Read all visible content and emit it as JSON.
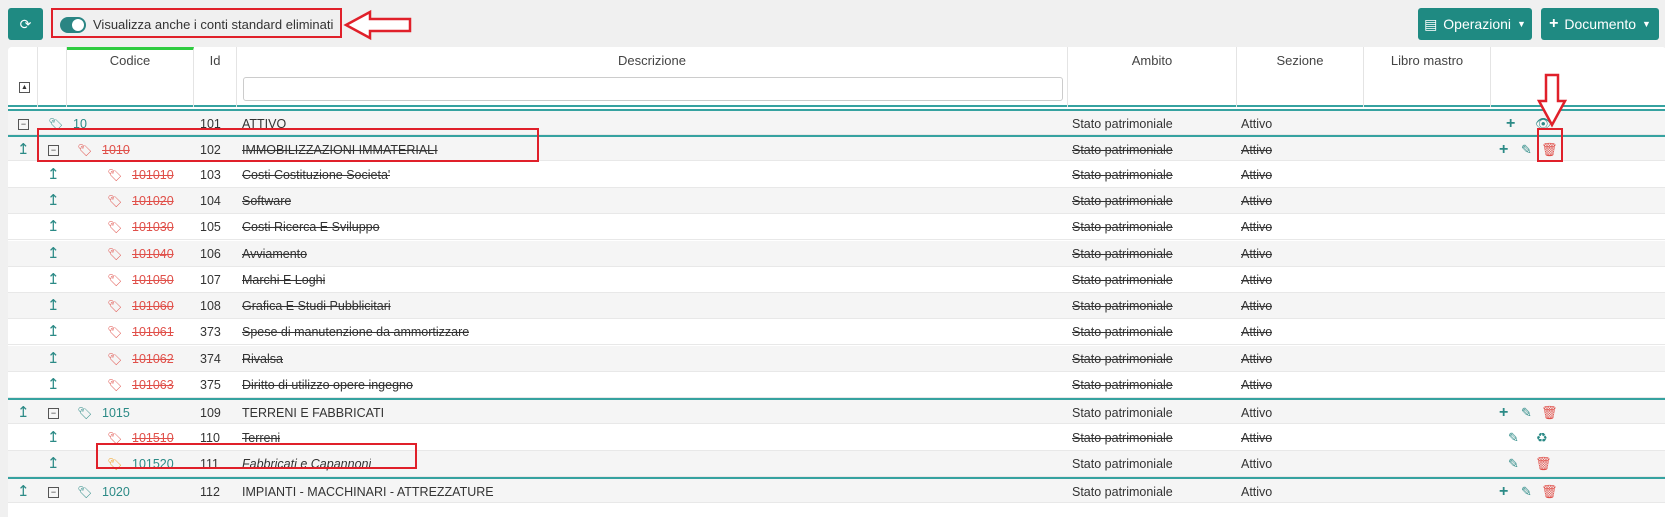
{
  "toolbar": {
    "refresh_icon": "refresh-icon",
    "toggle_label": "Visualizza anche i conti standard eliminati",
    "toggle_on": true,
    "operazioni_label": "Operazioni",
    "documento_label": "Documento",
    "accent": "#1f8a82"
  },
  "table": {
    "columns": [
      "Codice",
      "Id",
      "Descrizione",
      "Ambito",
      "Sezione",
      "Libro mastro"
    ],
    "description_filter_value": "",
    "rows": [
      {
        "codice": "10",
        "id": "101",
        "descrizione": "ATTIVO",
        "ambito": "Stato patrimoniale",
        "sezione": "Attivo",
        "deleted": false,
        "level": 0,
        "expandable": true,
        "tag": "teal",
        "actions": [
          "plus",
          "eye"
        ]
      },
      {
        "codice": "1010",
        "id": "102",
        "descrizione": "IMMOBILIZZAZIONI IMMATERIALI",
        "ambito": "Stato patrimoniale",
        "sezione": "Attivo",
        "deleted": true,
        "level": 1,
        "expandable": true,
        "tag": "red",
        "actions": [
          "plus",
          "edit",
          "trash"
        ]
      },
      {
        "codice": "101010",
        "id": "103",
        "descrizione": "Costi Costituzione Societa'",
        "ambito": "Stato patrimoniale",
        "sezione": "Attivo",
        "deleted": true,
        "level": 2,
        "tag": "red",
        "actions": []
      },
      {
        "codice": "101020",
        "id": "104",
        "descrizione": "Software",
        "ambito": "Stato patrimoniale",
        "sezione": "Attivo",
        "deleted": true,
        "level": 2,
        "tag": "red",
        "actions": []
      },
      {
        "codice": "101030",
        "id": "105",
        "descrizione": "Costi Ricerca E Sviluppo",
        "ambito": "Stato patrimoniale",
        "sezione": "Attivo",
        "deleted": true,
        "level": 2,
        "tag": "red",
        "actions": []
      },
      {
        "codice": "101040",
        "id": "106",
        "descrizione": "Avviamento",
        "ambito": "Stato patrimoniale",
        "sezione": "Attivo",
        "deleted": true,
        "level": 2,
        "tag": "red",
        "actions": []
      },
      {
        "codice": "101050",
        "id": "107",
        "descrizione": "Marchi E Loghi",
        "ambito": "Stato patrimoniale",
        "sezione": "Attivo",
        "deleted": true,
        "level": 2,
        "tag": "red",
        "actions": []
      },
      {
        "codice": "101060",
        "id": "108",
        "descrizione": "Grafica E Studi Pubblicitari",
        "ambito": "Stato patrimoniale",
        "sezione": "Attivo",
        "deleted": true,
        "level": 2,
        "tag": "red",
        "actions": []
      },
      {
        "codice": "101061",
        "id": "373",
        "descrizione": "Spese di manutenzione da ammortizzare",
        "ambito": "Stato patrimoniale",
        "sezione": "Attivo",
        "deleted": true,
        "level": 2,
        "tag": "red",
        "actions": []
      },
      {
        "codice": "101062",
        "id": "374",
        "descrizione": "Rivalsa",
        "ambito": "Stato patrimoniale",
        "sezione": "Attivo",
        "deleted": true,
        "level": 2,
        "tag": "red",
        "actions": []
      },
      {
        "codice": "101063",
        "id": "375",
        "descrizione": "Diritto di utilizzo opere ingegno",
        "ambito": "Stato patrimoniale",
        "sezione": "Attivo",
        "deleted": true,
        "level": 2,
        "tag": "red",
        "actions": []
      },
      {
        "codice": "1015",
        "id": "109",
        "descrizione": "TERRENI E FABBRICATI",
        "ambito": "Stato patrimoniale",
        "sezione": "Attivo",
        "deleted": false,
        "level": 1,
        "expandable": true,
        "tag": "teal",
        "actions": [
          "plus",
          "edit",
          "trash"
        ]
      },
      {
        "codice": "101510",
        "id": "110",
        "descrizione": "Terreni",
        "ambito": "Stato patrimoniale",
        "sezione": "Attivo",
        "deleted": true,
        "level": 2,
        "tag": "red",
        "actions": [
          "edit",
          "trash-restore"
        ]
      },
      {
        "codice": "101520",
        "id": "111",
        "descrizione": "Fabbricati e Capannoni",
        "ambito": "Stato patrimoniale",
        "sezione": "Attivo",
        "deleted": false,
        "italic": true,
        "level": 2,
        "tag": "orange",
        "actions": [
          "edit",
          "trash"
        ]
      },
      {
        "codice": "1020",
        "id": "112",
        "descrizione": "IMPIANTI - MACCHINARI - ATTREZZATURE",
        "ambito": "Stato patrimoniale",
        "sezione": "Attivo",
        "deleted": false,
        "level": 1,
        "expandable": true,
        "tag": "teal",
        "actions": [
          "plus",
          "edit",
          "trash"
        ]
      }
    ]
  },
  "annotation_color": "#e0202a"
}
